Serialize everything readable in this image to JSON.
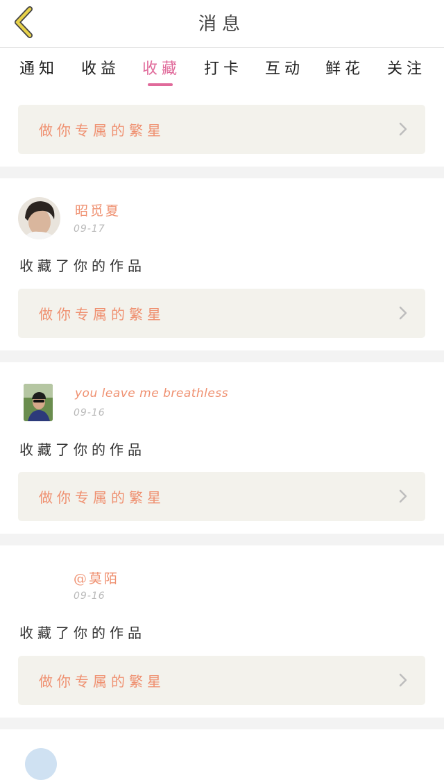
{
  "header": {
    "title": "消息"
  },
  "tabs": [
    {
      "label": "通知"
    },
    {
      "label": "收益"
    },
    {
      "label": "收藏"
    },
    {
      "label": "打卡"
    },
    {
      "label": "互动"
    },
    {
      "label": "鲜花"
    },
    {
      "label": "关注"
    }
  ],
  "active_tab": "收藏",
  "banner_label": "做你专属的繁星",
  "items": [
    {
      "username": "昭觅夏",
      "date": "09-17",
      "action": "收藏了你的作品",
      "banner": "做你专属的繁星"
    },
    {
      "username": "you leave me breathless",
      "date": "09-16",
      "action": "收藏了你的作品",
      "banner": "做你专属的繁星"
    },
    {
      "username": "@莫陌",
      "date": "09-16",
      "action": "收藏了你的作品",
      "banner": "做你专属的繁星"
    }
  ],
  "colors": {
    "accent": "#e06a9a",
    "banner_text": "#ef9070",
    "banner_bg": "#f3f2ec",
    "back_icon": "#e8d24a"
  }
}
